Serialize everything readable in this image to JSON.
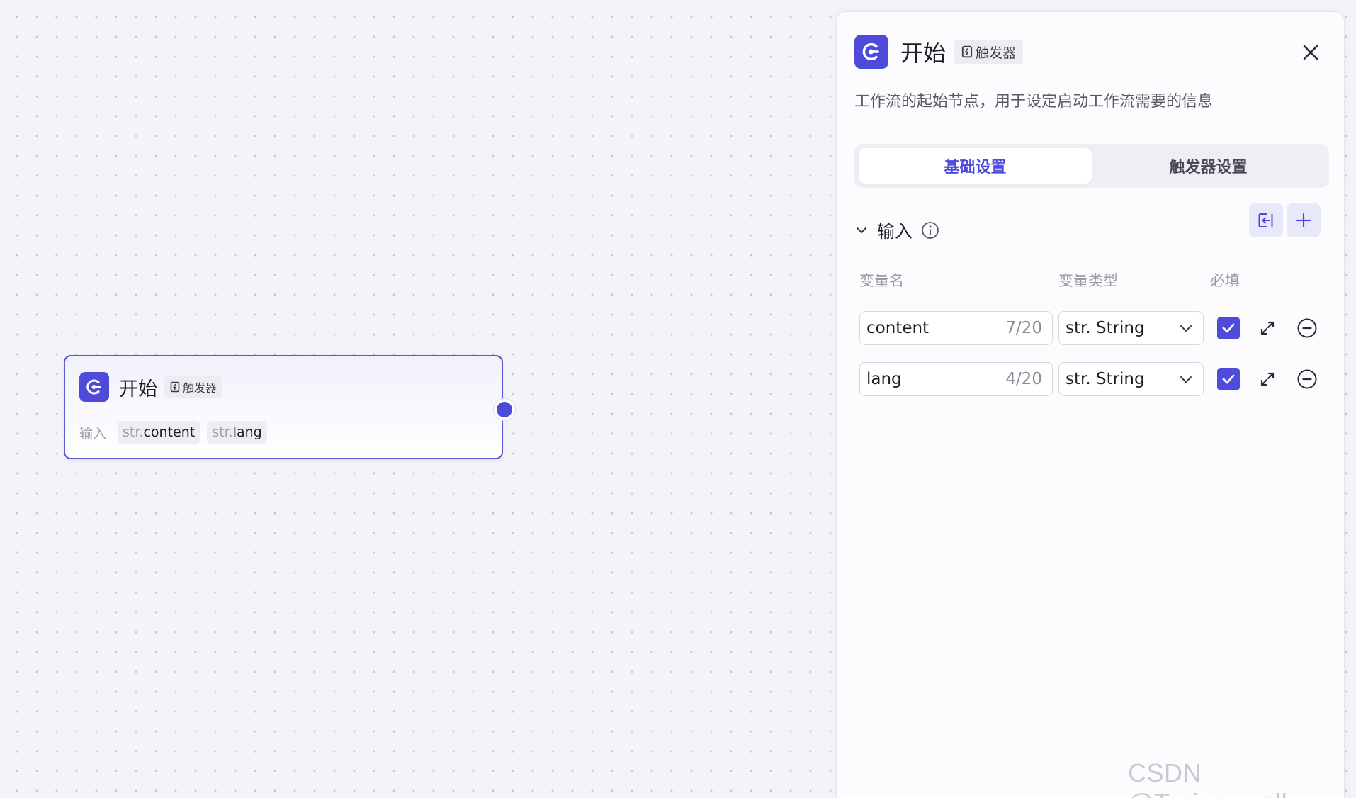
{
  "node": {
    "title": "开始",
    "tag": "触发器",
    "inputs_label": "输入",
    "chips": [
      {
        "prefix": "str.",
        "name": "content"
      },
      {
        "prefix": "str.",
        "name": "lang"
      }
    ]
  },
  "panel": {
    "title": "开始",
    "tag": "触发器",
    "description": "工作流的起始节点，用于设定启动工作流需要的信息",
    "tabs": [
      {
        "label": "基础设置",
        "active": true
      },
      {
        "label": "触发器设置",
        "active": false
      }
    ],
    "section_title": "输入",
    "columns": {
      "name": "变量名",
      "type": "变量类型",
      "required": "必填"
    },
    "variables": [
      {
        "name": "content",
        "count": "7/20",
        "type": "str. String",
        "required": true
      },
      {
        "name": "lang",
        "count": "4/20",
        "type": "str. String",
        "required": true
      }
    ]
  },
  "watermark": "CSDN @Turing_well",
  "colors": {
    "accent": "#4e4bdb",
    "canvas": "#f3f3f8"
  }
}
